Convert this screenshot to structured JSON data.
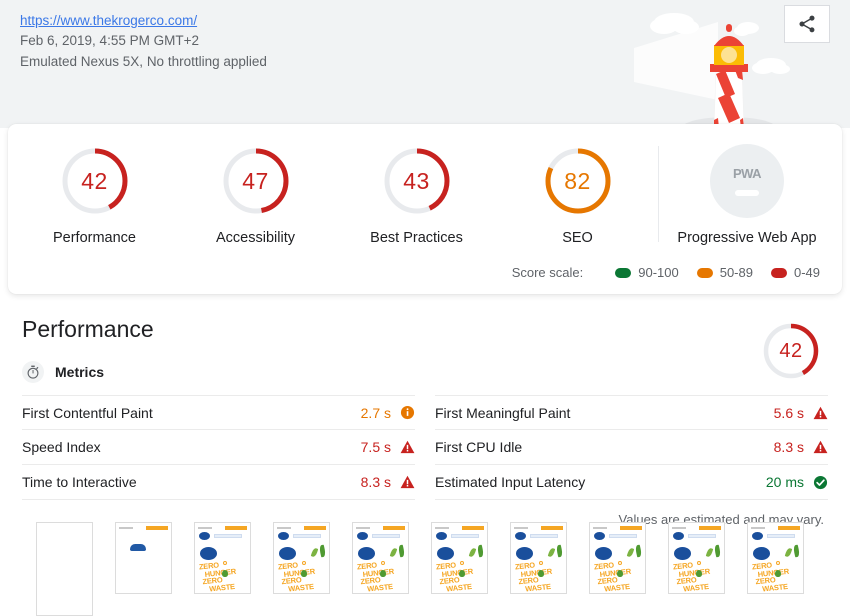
{
  "header": {
    "url": "https://www.thekrogerco.com/",
    "timestamp": "Feb 6, 2019, 4:55 PM GMT+2",
    "environment": "Emulated Nexus 5X, No throttling applied",
    "share_icon": "share-icon",
    "logo": "lighthouse-logo"
  },
  "scores": {
    "categories": [
      {
        "label": "Performance",
        "score": "42",
        "color": "#c7221f",
        "percent": 42
      },
      {
        "label": "Accessibility",
        "score": "47",
        "color": "#c7221f",
        "percent": 47
      },
      {
        "label": "Best Practices",
        "score": "43",
        "color": "#c7221f",
        "percent": 43
      },
      {
        "label": "SEO",
        "score": "82",
        "color": "#e67700",
        "percent": 82
      }
    ],
    "pwa": {
      "label": "Progressive Web App",
      "badge_text": "PWA",
      "state": "not-applicable"
    },
    "scale": {
      "label": "Score scale:",
      "items": [
        {
          "range": "90-100",
          "color": "#0b7734"
        },
        {
          "range": "50-89",
          "color": "#e67700"
        },
        {
          "range": "0-49",
          "color": "#c7221f"
        }
      ]
    }
  },
  "performance": {
    "title": "Performance",
    "gauge_score": "42",
    "gauge_color": "#c7221f",
    "gauge_percent": 42,
    "metrics_header": {
      "label": "Metrics",
      "icon": "stopwatch-icon"
    },
    "metrics_left": [
      {
        "name": "First Contentful Paint",
        "value": "2.7 s",
        "color": "#e67700",
        "icon": "info-circle-icon"
      },
      {
        "name": "Speed Index",
        "value": "7.5 s",
        "color": "#c7221f",
        "icon": "warning-triangle-icon"
      },
      {
        "name": "Time to Interactive",
        "value": "8.3 s",
        "color": "#c7221f",
        "icon": "warning-triangle-icon"
      }
    ],
    "metrics_right": [
      {
        "name": "First Meaningful Paint",
        "value": "5.6 s",
        "color": "#c7221f",
        "icon": "warning-triangle-icon"
      },
      {
        "name": "First CPU Idle",
        "value": "8.3 s",
        "color": "#c7221f",
        "icon": "warning-triangle-icon"
      },
      {
        "name": "Estimated Input Latency",
        "value": "20 ms",
        "color": "#0b7734",
        "icon": "check-circle-icon"
      }
    ],
    "estimate_note": "Values are estimated and may vary."
  },
  "filmstrip": {
    "frames": [
      {
        "state": "blank",
        "tall": true
      },
      {
        "state": "early"
      },
      {
        "state": "partial"
      },
      {
        "state": "loading"
      },
      {
        "state": "loading"
      },
      {
        "state": "loaded"
      },
      {
        "state": "loaded"
      },
      {
        "state": "loaded"
      },
      {
        "state": "loaded"
      },
      {
        "state": "loaded"
      }
    ],
    "brand_lines": [
      "ZERO",
      "HUNGER",
      "ZERO",
      "WASTE"
    ]
  }
}
